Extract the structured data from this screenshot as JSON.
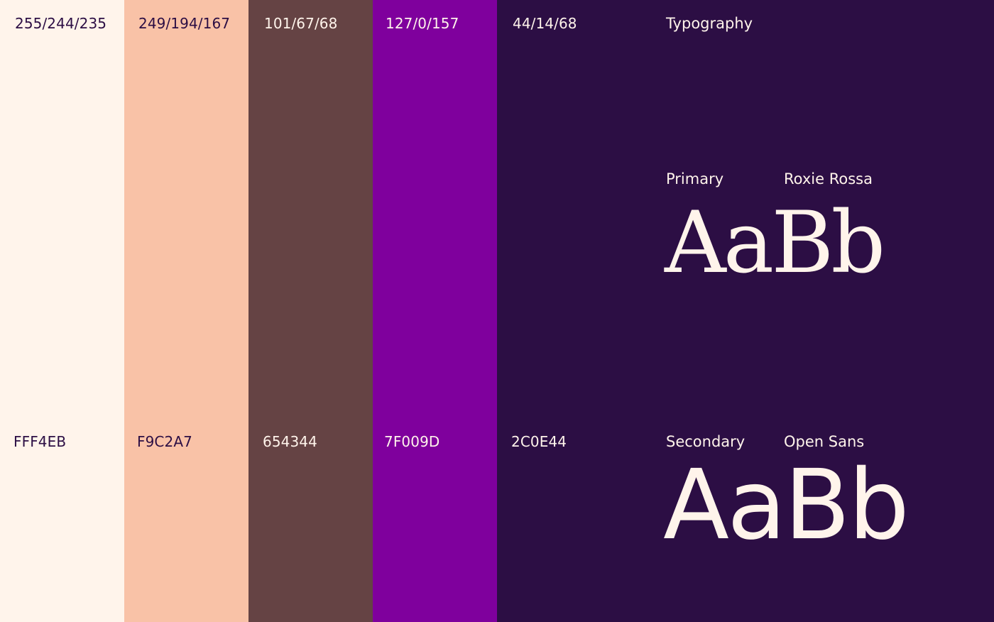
{
  "swatches": [
    {
      "rgb": "255/244/235",
      "hex": "FFF4EB",
      "color": "#FFF4EB"
    },
    {
      "rgb": "249/194/167",
      "hex": "F9C2A7",
      "color": "#F9C2A7"
    },
    {
      "rgb": "101/67/68",
      "hex": "654344",
      "color": "#654344"
    },
    {
      "rgb": "127/0/157",
      "hex": "7F009D",
      "color": "#7F009D"
    },
    {
      "rgb": "44/14/68",
      "hex": "2C0E44",
      "color": "#2C0E44"
    }
  ],
  "typography": {
    "title": "Typography",
    "primary": {
      "label": "Primary",
      "font_name": "Roxie Rossa",
      "specimen": "AaBb"
    },
    "secondary": {
      "label": "Secondary",
      "font_name": "Open Sans",
      "specimen": "AaBb"
    }
  },
  "colors": {
    "text_dark": "#2C0E44",
    "text_light": "#FFF4EB"
  }
}
